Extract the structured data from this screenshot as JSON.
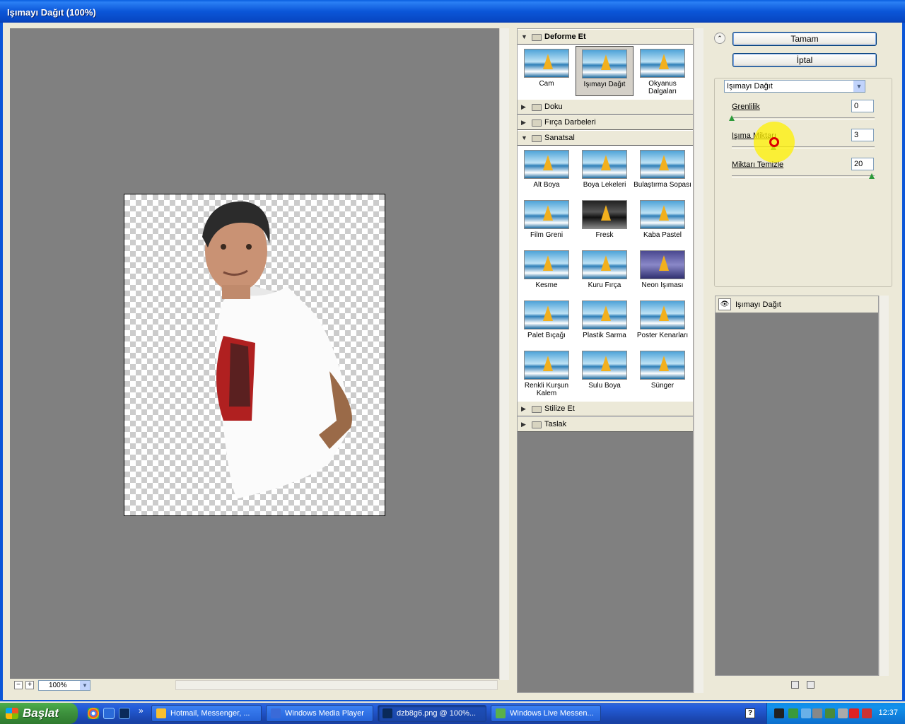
{
  "window": {
    "title": "Işımayı Dağıt (100%)"
  },
  "preview": {
    "zoom": "100%",
    "minus": "−",
    "plus": "+"
  },
  "gallery": {
    "categories": [
      {
        "name": "Deforme Et",
        "expanded": true,
        "items": [
          "Cam",
          "Işımayı Dağıt",
          "Okyanus Dalgaları"
        ],
        "selected": "Işımayı Dağıt"
      },
      {
        "name": "Doku",
        "expanded": false
      },
      {
        "name": "Fırça Darbeleri",
        "expanded": false
      },
      {
        "name": "Sanatsal",
        "expanded": true,
        "items": [
          "Alt Boya",
          "Boya Lekeleri",
          "Bulaştırma Sopası",
          "Film Greni",
          "Fresk",
          "Kaba Pastel",
          "Kesme",
          "Kuru Fırça",
          "Neon Işıması",
          "Palet Bıçağı",
          "Plastik Sarma",
          "Poster Kenarları",
          "Renkli Kurşun Kalem",
          "Sulu Boya",
          "Sünger"
        ]
      },
      {
        "name": "Stilize Et",
        "expanded": false
      },
      {
        "name": "Taslak",
        "expanded": false
      }
    ]
  },
  "buttons": {
    "ok": "Tamam",
    "cancel": "İptal"
  },
  "settings": {
    "filter": "Işımayı Dağıt",
    "params": [
      {
        "label": "Grenlilik",
        "value": "0",
        "fraction": 0.0
      },
      {
        "label": "Işıma Miktarı",
        "value": "3",
        "fraction": 0.3
      },
      {
        "label": "Miktarı Temizle",
        "value": "20",
        "fraction": 1.0
      }
    ]
  },
  "layers": {
    "items": [
      "Işımayı Dağıt"
    ]
  },
  "taskbar": {
    "start": "Başlat",
    "tasks": [
      "Hotmail, Messenger, ...",
      "Windows Media Player",
      "dzb8g6.png @ 100%...",
      "Windows Live Messen..."
    ],
    "active_task": "dzb8g6.png @ 100%...",
    "clock": "12:37"
  },
  "colors": {
    "titlebar": "#0b56d8",
    "accent_slider": "#2d9a3a",
    "preview_bg": "#808080"
  }
}
